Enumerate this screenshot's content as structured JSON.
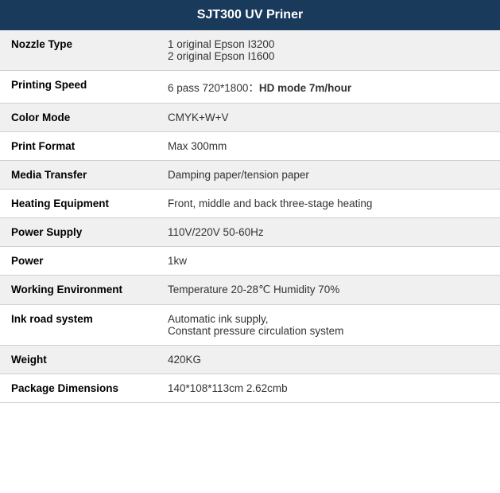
{
  "header": {
    "title": "SJT300 UV Priner"
  },
  "rows": [
    {
      "label": "Nozzle Type",
      "value": "1 original Epson I3200\n2 original Epson I1600",
      "hasHighlight": false
    },
    {
      "label": "Printing Speed",
      "valuePrefix": "6 pass 720*1800：",
      "valueBold": "HD mode 7m/hour",
      "hasHighlight": true
    },
    {
      "label": "Color Mode",
      "value": "CMYK+W+V",
      "hasHighlight": false
    },
    {
      "label": "Print Format",
      "value": "Max 300mm",
      "hasHighlight": false
    },
    {
      "label": "Media Transfer",
      "value": "Damping paper/tension paper",
      "hasHighlight": false
    },
    {
      "label": "Heating Equipment",
      "value": "Front, middle and back three-stage heating",
      "hasHighlight": false
    },
    {
      "label": "Power Supply",
      "value": "110V/220V 50-60Hz",
      "hasHighlight": false
    },
    {
      "label": "Power",
      "value": "1kw",
      "hasHighlight": false
    },
    {
      "label": "Working Environment",
      "value": "Temperature 20-28℃  Humidity 70%",
      "hasHighlight": false
    },
    {
      "label": "Ink road system",
      "value": "Automatic ink supply,\nConstant pressure circulation system",
      "hasHighlight": false
    },
    {
      "label": "Weight",
      "value": "420KG",
      "hasHighlight": false
    },
    {
      "label": "Package Dimensions",
      "value": "140*108*113cm 2.62cmb",
      "hasHighlight": false
    }
  ]
}
